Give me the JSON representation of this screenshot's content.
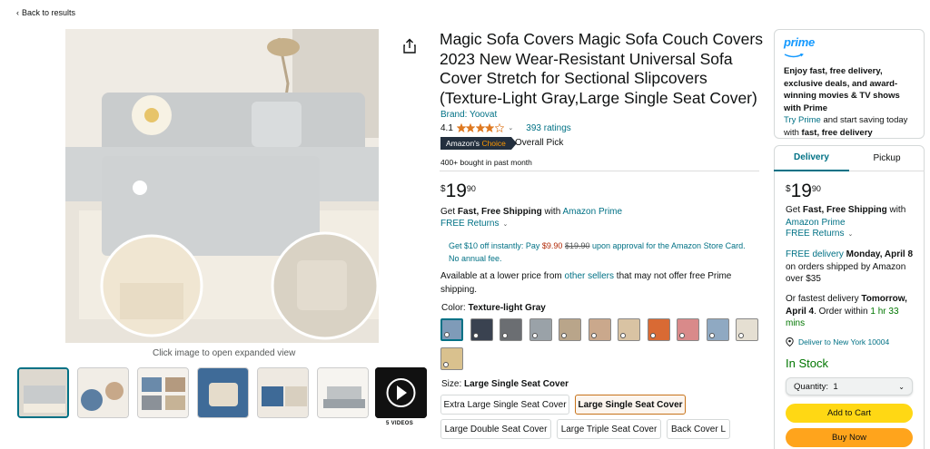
{
  "nav": {
    "back_label": "Back to results"
  },
  "gallery": {
    "expand_caption": "Click image to open expanded view",
    "videos_label": "5 VIDEOS"
  },
  "product": {
    "title": "Magic Sofa Covers Magic Sofa Couch Covers 2023 New Wear-Resistant Universal Sofa Cover Stretch for Sectional Slipcovers (Texture-Light Gray,Large Single Seat Cover)",
    "brand": "Brand: Yoovat",
    "rating": "4.1",
    "rating_value": 4.1,
    "rating_count": "393 ratings",
    "badge_prefix": "Amazon's",
    "badge_suffix": "Choice",
    "overall_pick": "Overall Pick",
    "bought": "400+ bought in past month",
    "price": {
      "symbol": "$",
      "whole": "19",
      "fraction": "90"
    },
    "ship_prefix": "Get ",
    "ship_bold": "Fast, Free Shipping",
    "ship_with": " with ",
    "ship_link": "Amazon Prime",
    "free_returns": "FREE Returns",
    "card_offer": {
      "pre": "Get $10 off instantly: Pay ",
      "new_price": "$9.90",
      "old_price": "$19.90",
      "post": " upon approval for the Amazon Store Card. No annual fee."
    },
    "lower_price": {
      "pre": "Available at a lower price from ",
      "link": "other sellers",
      "post": " that may not offer free Prime shipping."
    },
    "color_label": "Color: ",
    "color_value": "Texture-light Gray",
    "size_label": "Size: ",
    "size_value": "Large Single Seat Cover",
    "sizes": [
      "Extra Large Single Seat Cover",
      "Large Single Seat Cover",
      "Large Double Seat Cover",
      "Large Triple Seat Cover",
      "Back Cover L"
    ]
  },
  "prime_box": {
    "logo": "prime",
    "text": "Enjoy fast, free delivery, exclusive deals, and award-winning movies & TV shows with Prime",
    "try_link": "Try Prime",
    "try_rest": " and start saving today with ",
    "try_bold": "fast, free delivery"
  },
  "buybox": {
    "tab_delivery": "Delivery",
    "tab_pickup": "Pickup",
    "price": {
      "symbol": "$",
      "whole": "19",
      "fraction": "90"
    },
    "ship_prefix": "Get ",
    "ship_bold": "Fast, Free Shipping",
    "ship_with": " with ",
    "ship_link": "Amazon Prime",
    "free_returns": "FREE Returns",
    "delivery_link": "FREE delivery",
    "delivery_date": " Monday, April 8",
    "delivery_rest": " on orders shipped by Amazon over $35",
    "fastest_pre": "Or fastest delivery ",
    "fastest_date": "Tomorrow, April 4",
    "fastest_mid": ". Order within ",
    "fastest_time": "1 hr 33 mins",
    "deliver_to": "Deliver to New York 10004",
    "stock": "In Stock",
    "qty_label": "Quantity:",
    "qty_value": "1",
    "add_to_cart": "Add to Cart",
    "buy_now": "Buy Now"
  },
  "colors": {
    "accent_link": "#007185",
    "price_red": "#b12704",
    "stock_green": "#007600",
    "add_cart_yellow": "#ffd814",
    "buy_now_orange": "#ffa41c",
    "prime_blue": "#1399ff"
  },
  "swatch_colors": [
    "#7f9bb8",
    "#3a4250",
    "#6b6e72",
    "#9aa2a8",
    "#b9a58a",
    "#caa88c",
    "#d9c3a3",
    "#d96a34",
    "#d98a8a",
    "#8fa9c2",
    "#e5dfd2",
    "#d9c18e"
  ]
}
